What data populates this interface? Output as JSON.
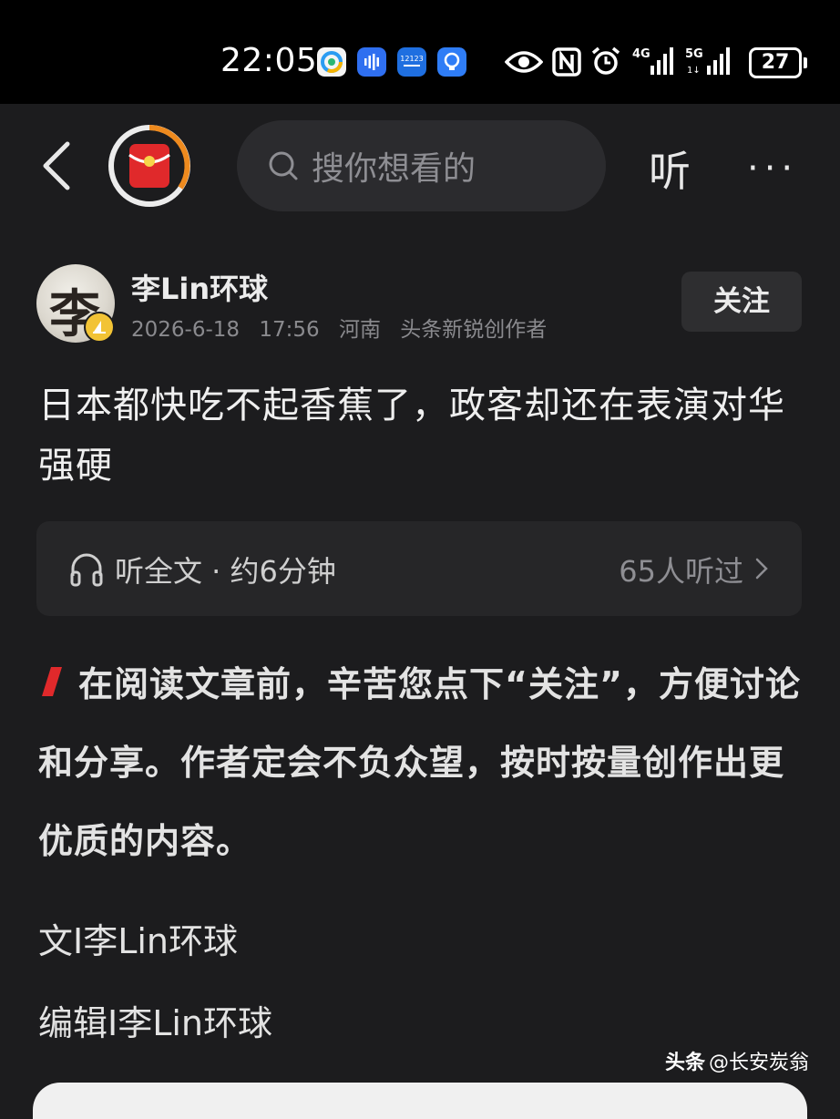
{
  "status_bar": {
    "time": "22:05",
    "battery": "27",
    "icons": [
      "app-icon-1",
      "voice-app-icon",
      "12123-app-icon",
      "bulb-app-icon",
      "eye-icon",
      "nfc-icon",
      "alarm-icon",
      "4g-signal-icon",
      "5g-signal-icon",
      "battery-icon"
    ]
  },
  "nav": {
    "search_placeholder": "搜你想看的",
    "listen_label": "听",
    "more_label": "···"
  },
  "author": {
    "avatar_char": "李",
    "name": "李Lin环球",
    "date": "2026-6-18",
    "time": "17:56",
    "location": "河南",
    "role": "头条新锐创作者",
    "follow_label": "关注"
  },
  "article": {
    "title": "日本都快吃不起香蕉了，政客却还在表演对华强硬",
    "audio_label": "听全文 · 约6分钟",
    "audio_listeners": "65人听过",
    "intro": "在阅读文章前，辛苦您点下“关注”，方便讨论和分享。作者定会不负众望，按时按量创作出更优质的内容。",
    "credit_writer": "文I李Lin环球",
    "credit_editor": "编辑I李Lin环球"
  },
  "watermark": {
    "brand": "头条",
    "handle": "@长安炭翁"
  },
  "colors": {
    "background": "#1c1c1e",
    "accent_red": "#e0292b",
    "badge_yellow": "#f2c335",
    "ring_orange": "#ee8a1e"
  }
}
